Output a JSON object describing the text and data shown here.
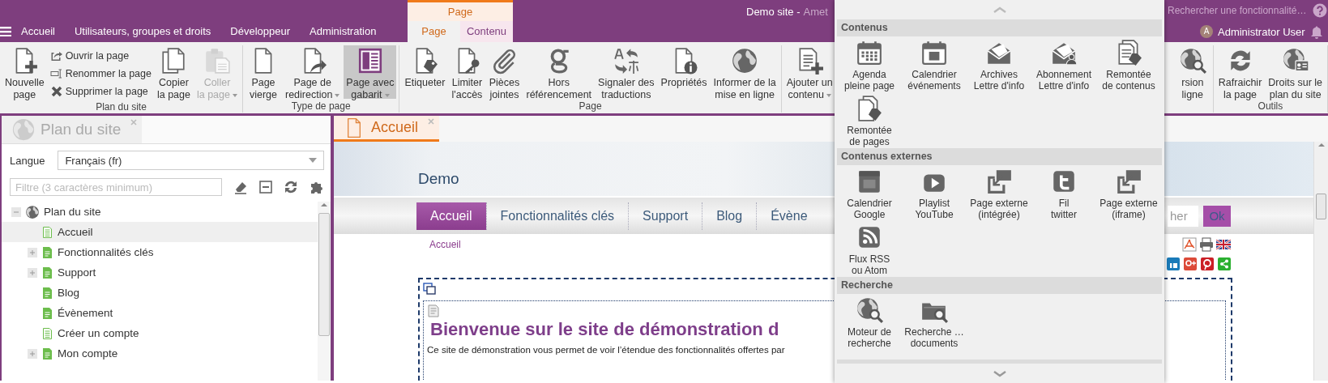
{
  "topbar": {
    "tabs": [
      {
        "label": "Accueil",
        "selected": false
      },
      {
        "label": "Utilisateurs, groupes et droits",
        "selected": false
      },
      {
        "label": "Développeur",
        "selected": false
      },
      {
        "label": "Administration",
        "selected": false
      }
    ],
    "context_group": {
      "title": "Page",
      "tabs": [
        {
          "label": "Page",
          "selected": true
        },
        {
          "label": "Contenu",
          "selected": false
        }
      ]
    },
    "site_title": "Demo site -",
    "site_subtitle": "Amet",
    "search": {
      "placeholder": "Rechercher une fonctionnalité…"
    },
    "user": {
      "initial": "A",
      "name": "Administrator User"
    }
  },
  "ribbon": {
    "groups": [
      {
        "label": "Plan du site",
        "items": [
          {
            "kind": "large",
            "label": "Nouvelle\npage",
            "disabled": false,
            "pressed": false,
            "dropdown": false
          },
          {
            "kind": "stack",
            "items": [
              {
                "label": "Ouvrir la page",
                "disabled": false
              },
              {
                "label": "Renommer la page",
                "disabled": false
              },
              {
                "label": "Supprimer la page",
                "disabled": false
              }
            ]
          },
          {
            "kind": "large",
            "label": "Copier\nla page",
            "disabled": false,
            "pressed": false,
            "dropdown": false
          },
          {
            "kind": "large",
            "label": "Coller\nla page",
            "disabled": true,
            "pressed": false,
            "dropdown": true
          }
        ]
      },
      {
        "label": "Type de page",
        "items": [
          {
            "kind": "large",
            "label": "Page\nvierge",
            "disabled": false,
            "pressed": false,
            "dropdown": false
          },
          {
            "kind": "large",
            "label": "Page de\nredirection",
            "disabled": false,
            "pressed": false,
            "dropdown": true
          },
          {
            "kind": "large",
            "label": "Page avec\ngabarit",
            "disabled": false,
            "pressed": true,
            "dropdown": true
          }
        ]
      },
      {
        "label": "Page",
        "items": [
          {
            "kind": "large",
            "label": "Etiqueter",
            "disabled": false,
            "pressed": false,
            "dropdown": false
          },
          {
            "kind": "large",
            "label": "Limiter\nl'accès",
            "disabled": false,
            "pressed": false,
            "dropdown": false
          },
          {
            "kind": "large",
            "label": "Pièces\njointes",
            "disabled": false,
            "pressed": false,
            "dropdown": false
          },
          {
            "kind": "large",
            "label": "Hors\nréférencement",
            "disabled": false,
            "pressed": false,
            "dropdown": false
          },
          {
            "kind": "large",
            "label": "Signaler des\ntraductions",
            "disabled": false,
            "pressed": false,
            "dropdown": false
          },
          {
            "kind": "large",
            "label": "Propriétés",
            "disabled": false,
            "pressed": false,
            "dropdown": false
          },
          {
            "kind": "large",
            "label": "Informer de la\nmise en ligne",
            "disabled": false,
            "pressed": false,
            "dropdown": false
          }
        ]
      },
      {
        "items": [
          {
            "kind": "large",
            "label": "Ajouter un\ncontenu",
            "disabled": false,
            "pressed": false,
            "dropdown": true
          },
          {
            "kind": "large",
            "label": "rsion\nligne",
            "disabled": false,
            "pressed": false,
            "dropdown": false
          }
        ]
      },
      {
        "label": "Outils",
        "items": [
          {
            "kind": "large",
            "label": "Rafraichir\nla page",
            "disabled": false,
            "pressed": false,
            "dropdown": false
          },
          {
            "kind": "large",
            "label": "Droits sur le\nplan du site",
            "disabled": false,
            "pressed": false,
            "dropdown": false
          }
        ]
      }
    ]
  },
  "sitemap": {
    "tab": {
      "label": "Plan du site",
      "selected": false
    },
    "language": {
      "label": "Langue",
      "value": "Français (fr)"
    },
    "filter": {
      "placeholder": "Filtre (3 caractères minimum)"
    },
    "tree": {
      "label": "Plan du site",
      "expanded": true,
      "selected": false,
      "children": [
        {
          "label": "Accueil",
          "kind": "outline",
          "selected": true
        },
        {
          "label": "Fonctionnalités clés",
          "kind": "filled",
          "selected": false,
          "expanded": false
        },
        {
          "label": "Support",
          "kind": "filled",
          "selected": false,
          "expanded": false
        },
        {
          "label": "Blog",
          "kind": "filled",
          "selected": false
        },
        {
          "label": "Évènement",
          "kind": "filled",
          "selected": false
        },
        {
          "label": "Créer un compte",
          "kind": "outline",
          "selected": false
        },
        {
          "label": "Mon compte",
          "kind": "filled",
          "selected": false,
          "expanded": false
        }
      ]
    }
  },
  "page": {
    "tab": {
      "label": "Accueil",
      "selected": true
    },
    "banner": {
      "subtitle": "Demo"
    },
    "nav": [
      {
        "label": "Accueil",
        "selected": true
      },
      {
        "label": "Fonctionnalités clés",
        "selected": false
      },
      {
        "label": "Support",
        "selected": false
      },
      {
        "label": "Blog",
        "selected": false
      },
      {
        "label": "Évène",
        "selected": false
      }
    ],
    "search": {
      "placeholder": "her",
      "button": "Ok"
    },
    "breadcrumb": "Accueil",
    "heading": "Bienvenue sur le site de démonstration d",
    "paragraph": "Ce site de démonstration vous permet de voir l’étendue des fonctionnalités offertes par"
  },
  "insert_menu": {
    "sections": [
      {
        "title": "Contenus",
        "items": [
          "Agenda\npleine page",
          "Calendrier\névénements",
          "Archives\nLettre d'info",
          "Abonnement\nLettre d'info",
          "Remontée\nde contenus",
          "Remontée\nde pages"
        ]
      },
      {
        "title": "Contenus externes",
        "items": [
          "Calendrier\nGoogle",
          "Playlist\nYouTube",
          "Page externe\n(intégrée)",
          "Fil\ntwitter",
          "Page externe\n(iframe)",
          "Flux RSS\nou Atom"
        ]
      },
      {
        "title": "Recherche",
        "items": [
          "Moteur de\nrecherche",
          "Recherche …\ndocuments"
        ]
      }
    ]
  }
}
